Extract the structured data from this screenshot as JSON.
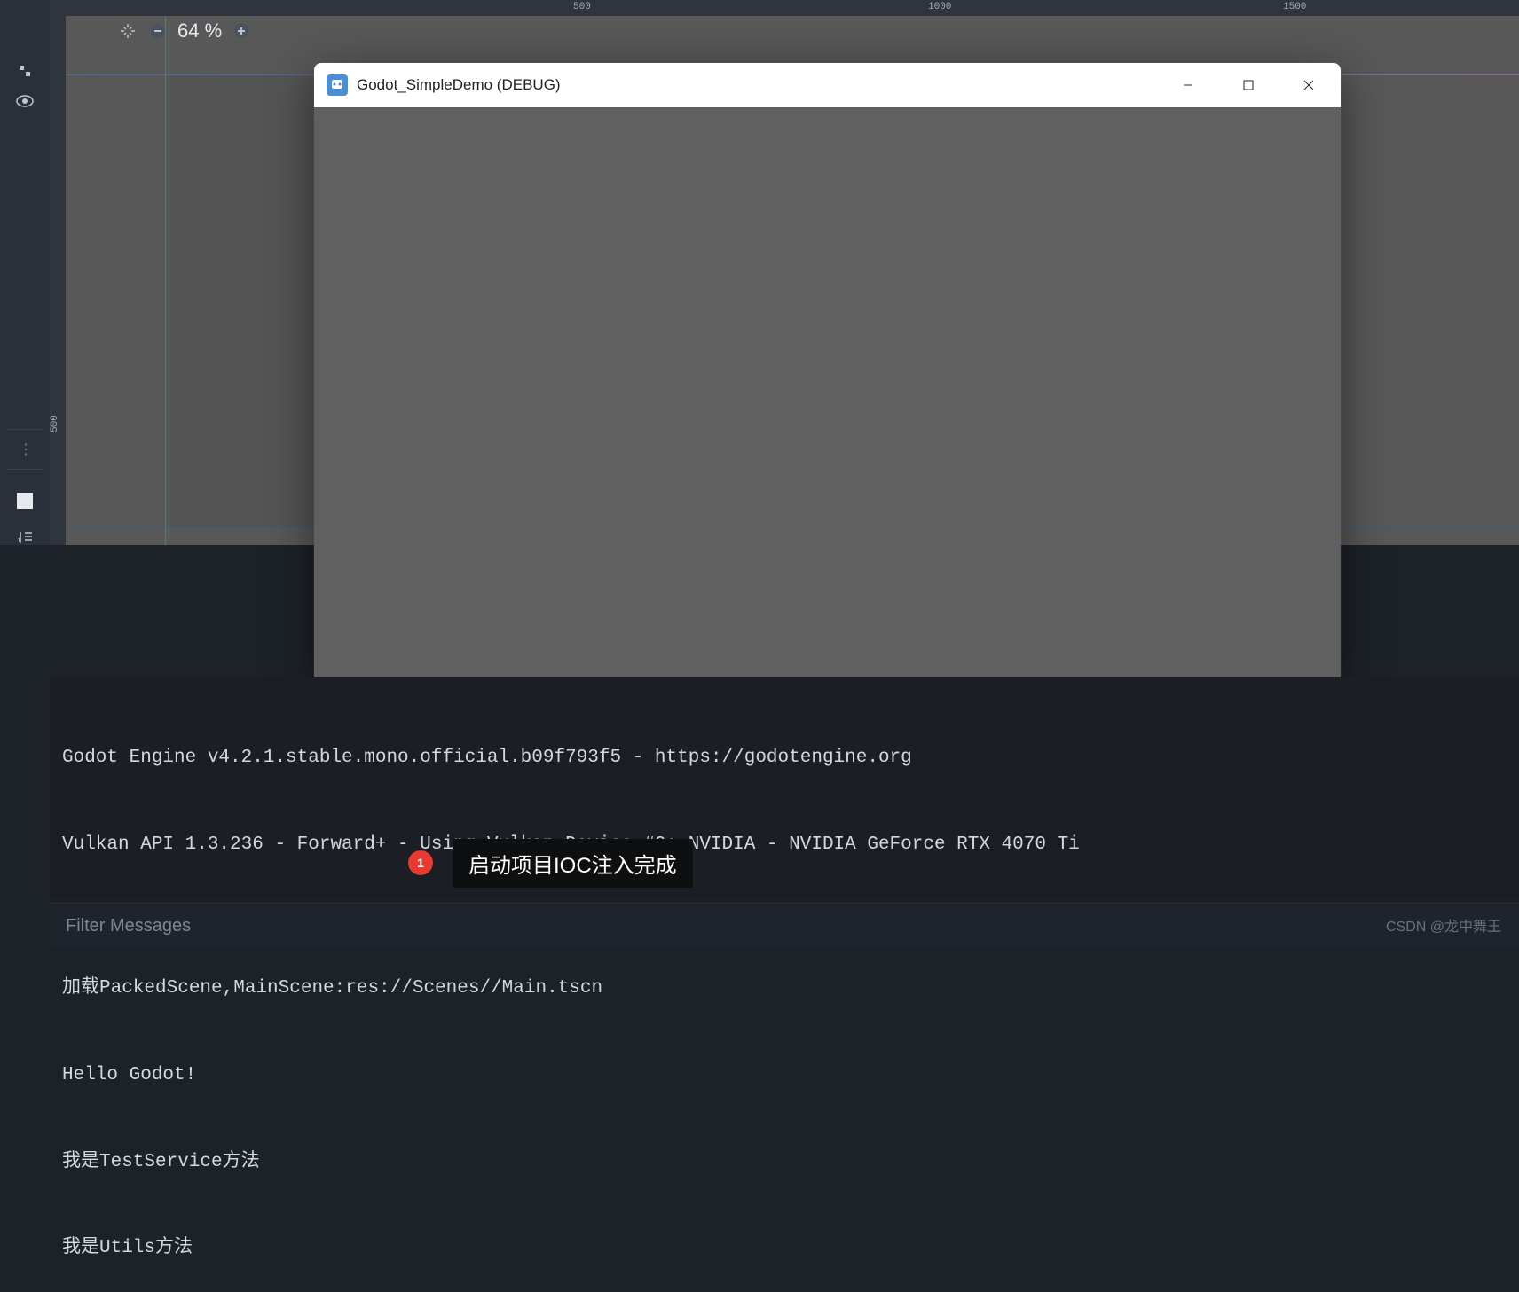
{
  "zoom": {
    "level": "64 %"
  },
  "ruler": {
    "top": [
      "500",
      "1000",
      "1500"
    ],
    "left": [
      "500"
    ]
  },
  "game_window": {
    "title": "Godot_SimpleDemo (DEBUG)"
  },
  "output": {
    "lines": [
      "Godot Engine v4.2.1.stable.mono.official.b09f793f5 - https://godotengine.org",
      "Vulkan API 1.3.236 - Forward+ - Using Vulkan Device #0: NVIDIA - NVIDIA GeForce RTX 4070 Ti",
      "",
      "加载PackedScene,MainScene:res://Scenes//Main.tscn",
      "Hello Godot!",
      "我是TestService方法",
      "我是Utils方法"
    ]
  },
  "filter": {
    "placeholder": "Filter Messages"
  },
  "annotation": {
    "badge": "1",
    "label": "启动项目IOC注入完成"
  },
  "watermark": "CSDN @龙中舞王",
  "icons": {
    "move": "move-icon",
    "eye": "eye-icon",
    "minus": "–",
    "plus": "+",
    "order": "order-icon"
  }
}
